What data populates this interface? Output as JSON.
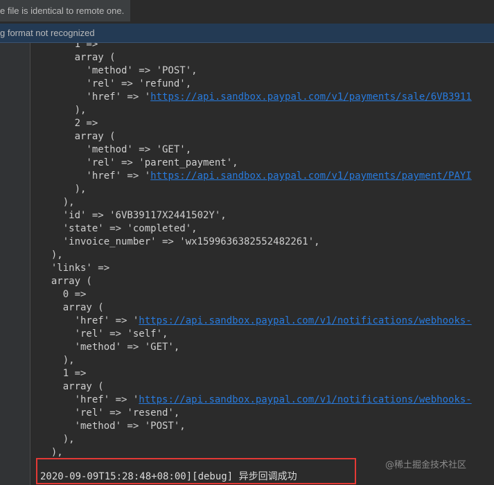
{
  "notification": {
    "text": "e file is identical to remote one."
  },
  "warning_bar": {
    "text": "g format not recognized"
  },
  "code_lines": [
    {
      "text": "      1 =>"
    },
    {
      "text": "      array ("
    },
    {
      "text": "        'method' => 'POST',"
    },
    {
      "text": "        'rel' => 'refund',"
    },
    {
      "text": "        'href' => '",
      "link": "https://api.sandbox.paypal.com/v1/payments/sale/6VB3911"
    },
    {
      "text": "      ),"
    },
    {
      "text": "      2 =>"
    },
    {
      "text": "      array ("
    },
    {
      "text": "        'method' => 'GET',"
    },
    {
      "text": "        'rel' => 'parent_payment',"
    },
    {
      "text": "        'href' => '",
      "link": "https://api.sandbox.paypal.com/v1/payments/payment/PAYI"
    },
    {
      "text": "      ),"
    },
    {
      "text": "    ),"
    },
    {
      "text": "    'id' => '6VB39117X2441502Y',"
    },
    {
      "text": "    'state' => 'completed',"
    },
    {
      "text": "    'invoice_number' => 'wx1599636382552482261',"
    },
    {
      "text": "  ),"
    },
    {
      "text": "  'links' =>"
    },
    {
      "text": "  array ("
    },
    {
      "text": "    0 =>"
    },
    {
      "text": "    array ("
    },
    {
      "text": "      'href' => '",
      "link": "https://api.sandbox.paypal.com/v1/notifications/webhooks-"
    },
    {
      "text": "      'rel' => 'self',"
    },
    {
      "text": "      'method' => 'GET',"
    },
    {
      "text": "    ),"
    },
    {
      "text": "    1 =>"
    },
    {
      "text": "    array ("
    },
    {
      "text": "      'href' => '",
      "link": "https://api.sandbox.paypal.com/v1/notifications/webhooks-"
    },
    {
      "text": "      'rel' => 'resend',"
    },
    {
      "text": "      'method' => 'POST',"
    },
    {
      "text": "    ),"
    },
    {
      "text": "  ),"
    }
  ],
  "log_line": {
    "timestamp": "2020-09-09T15:28:48+08:00][debug]",
    "message": "异步回调成功"
  },
  "watermark": {
    "text": "@稀土掘金技术社区"
  },
  "colors": {
    "background": "#2b2b2b",
    "link": "#287bde",
    "highlight_border": "#e53935",
    "warning_bar": "#233a54"
  }
}
